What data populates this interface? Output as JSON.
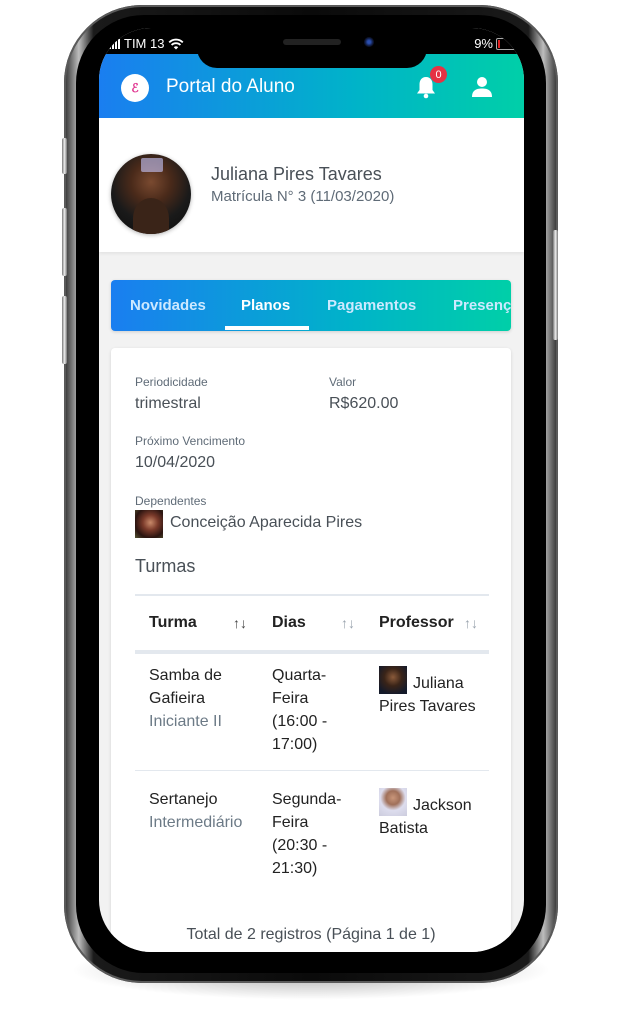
{
  "statusbar": {
    "carrier": "TIM 13",
    "battery": "9%",
    "signal_icon": "signal-icon",
    "wifi_icon": "wifi-icon",
    "battery_icon": "battery-icon"
  },
  "appbar": {
    "title": "Portal do Aluno",
    "logo_text": "ℰ",
    "notification_count": "0",
    "colors": {
      "gradient_start": "#1a7ef0",
      "gradient_end": "#00cfa8",
      "badge": "#e53244"
    }
  },
  "profile": {
    "name": "Juliana Pires Tavares",
    "subtitle": "Matrícula N° 3 (11/03/2020)"
  },
  "tabs": [
    {
      "label": "Novidades",
      "active": false
    },
    {
      "label": "Planos",
      "active": true
    },
    {
      "label": "Pagamentos",
      "active": false
    },
    {
      "label": "Presenç",
      "active": false
    }
  ],
  "plan": {
    "periodicidade_label": "Periodicidade",
    "periodicidade_value": "trimestral",
    "valor_label": "Valor",
    "valor_value": "R$620.00",
    "vencimento_label": "Próximo Vencimento",
    "vencimento_value": "10/04/2020",
    "dependentes_label": "Dependentes",
    "dependentes": [
      {
        "name": "Conceição Aparecida Pires"
      }
    ]
  },
  "turmas": {
    "title": "Turmas",
    "columns": [
      {
        "label": "Turma",
        "sort": "↑↓"
      },
      {
        "label": "Dias",
        "sort": "↑↓"
      },
      {
        "label": "Professor",
        "sort": "↑↓"
      }
    ],
    "rows": [
      {
        "turma_line1": "Samba de",
        "turma_line2": "Gafieira",
        "level": "Iniciante II",
        "dias_lines": [
          "Quarta-",
          "Feira",
          "(16:00 -",
          "17:00)"
        ],
        "professor_line1": "Juliana",
        "professor_line2": "Pires Tavares"
      },
      {
        "turma_line1": "Sertanejo",
        "turma_line2": "",
        "level": "Intermediário",
        "dias_lines": [
          "Segunda-",
          "Feira",
          "(20:30 -",
          "21:30)"
        ],
        "professor_line1": "Jackson",
        "professor_line2": "Batista"
      }
    ],
    "footer": "Total de 2 registros (Página 1 de 1)"
  }
}
